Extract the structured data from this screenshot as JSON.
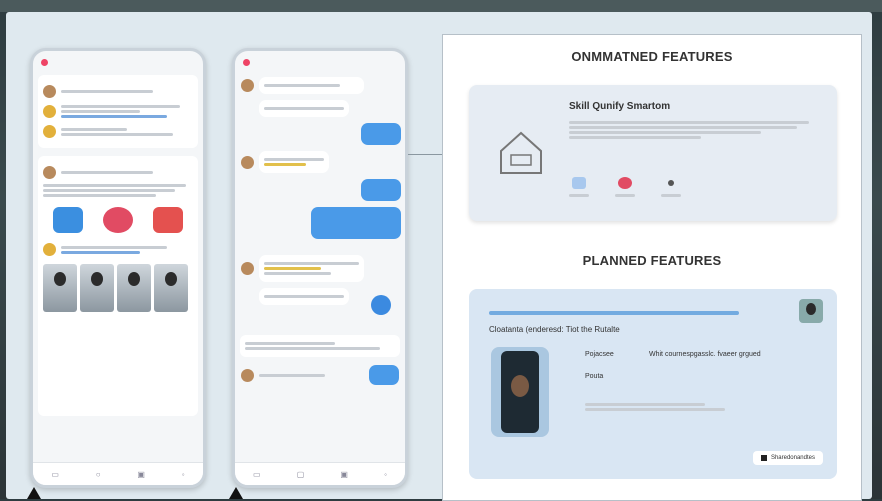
{
  "colors": {
    "accent": "#3b8ae0",
    "panel": "#dfe9ef",
    "feature_bg": "#e6ecf3",
    "planned_bg": "#d9e6f3"
  },
  "right_card": {
    "current_title": "ONMMATNED FEATURES",
    "feature_title": "Skill Qunify Smartom",
    "feature_icons": [
      {
        "icon": "grid-icon",
        "color": "#a8c8ee"
      },
      {
        "icon": "drop-icon",
        "color": "#e14b63"
      },
      {
        "icon": "star-icon",
        "color": "#555555"
      }
    ],
    "planned_title": "PLANNED FEATURES",
    "planned_subtitle": "Cloatanta (enderesd: Tiot the Rutalte",
    "labels": [
      "Pojacsee",
      "Pouta"
    ],
    "field_value": "Whit cournespgasslc. fvaeer grgued",
    "button_label": "Sharedonandtes"
  }
}
